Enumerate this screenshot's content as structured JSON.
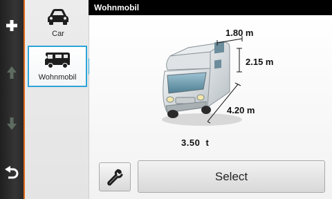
{
  "header": {
    "title": "Wohnmobil"
  },
  "vehicle_list": {
    "items": [
      {
        "label": "Car",
        "icon": "car-icon"
      },
      {
        "label": "Wohnmobil",
        "icon": "camper-icon",
        "selected": true
      }
    ]
  },
  "dimensions": {
    "width": "1.80 m",
    "height": "2.15 m",
    "length": "4.20 m",
    "weight": "3.50  t"
  },
  "actions": {
    "select_label": "Select",
    "tool_icon": "wrench-icon"
  },
  "side_toolbar": {
    "icons": [
      "plus-icon",
      "up-arrow-icon",
      "down-arrow-icon",
      "back-icon"
    ]
  },
  "colors": {
    "accent_blue": "#2aa4d8",
    "edge_orange": "#e06a1a",
    "header_bg": "#000000"
  }
}
